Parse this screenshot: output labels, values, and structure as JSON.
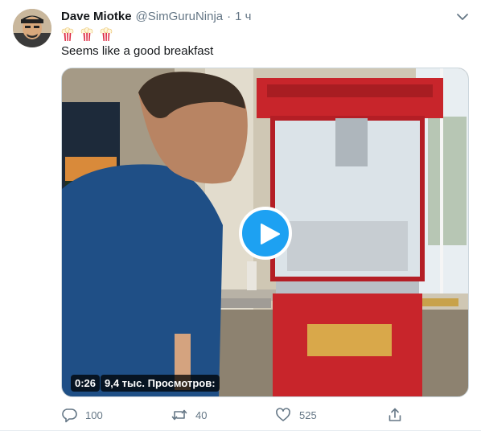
{
  "tweet": {
    "display_name": "Dave Miotke",
    "handle": "@SimGuruNinja",
    "separator": "·",
    "time": "1 ч",
    "emoji_icons": [
      "popcorn-icon",
      "popcorn-icon",
      "popcorn-icon"
    ],
    "text": "Seems like a good breakfast"
  },
  "media": {
    "duration": "0:26",
    "views": "9,4 тыс. Просмотров:",
    "play_icon": "play-icon"
  },
  "actions": {
    "reply_count": "100",
    "retweet_count": "40",
    "like_count": "525"
  },
  "colors": {
    "accent": "#1da1f2",
    "secondary_text": "#657786",
    "border": "#e6ecf0"
  }
}
